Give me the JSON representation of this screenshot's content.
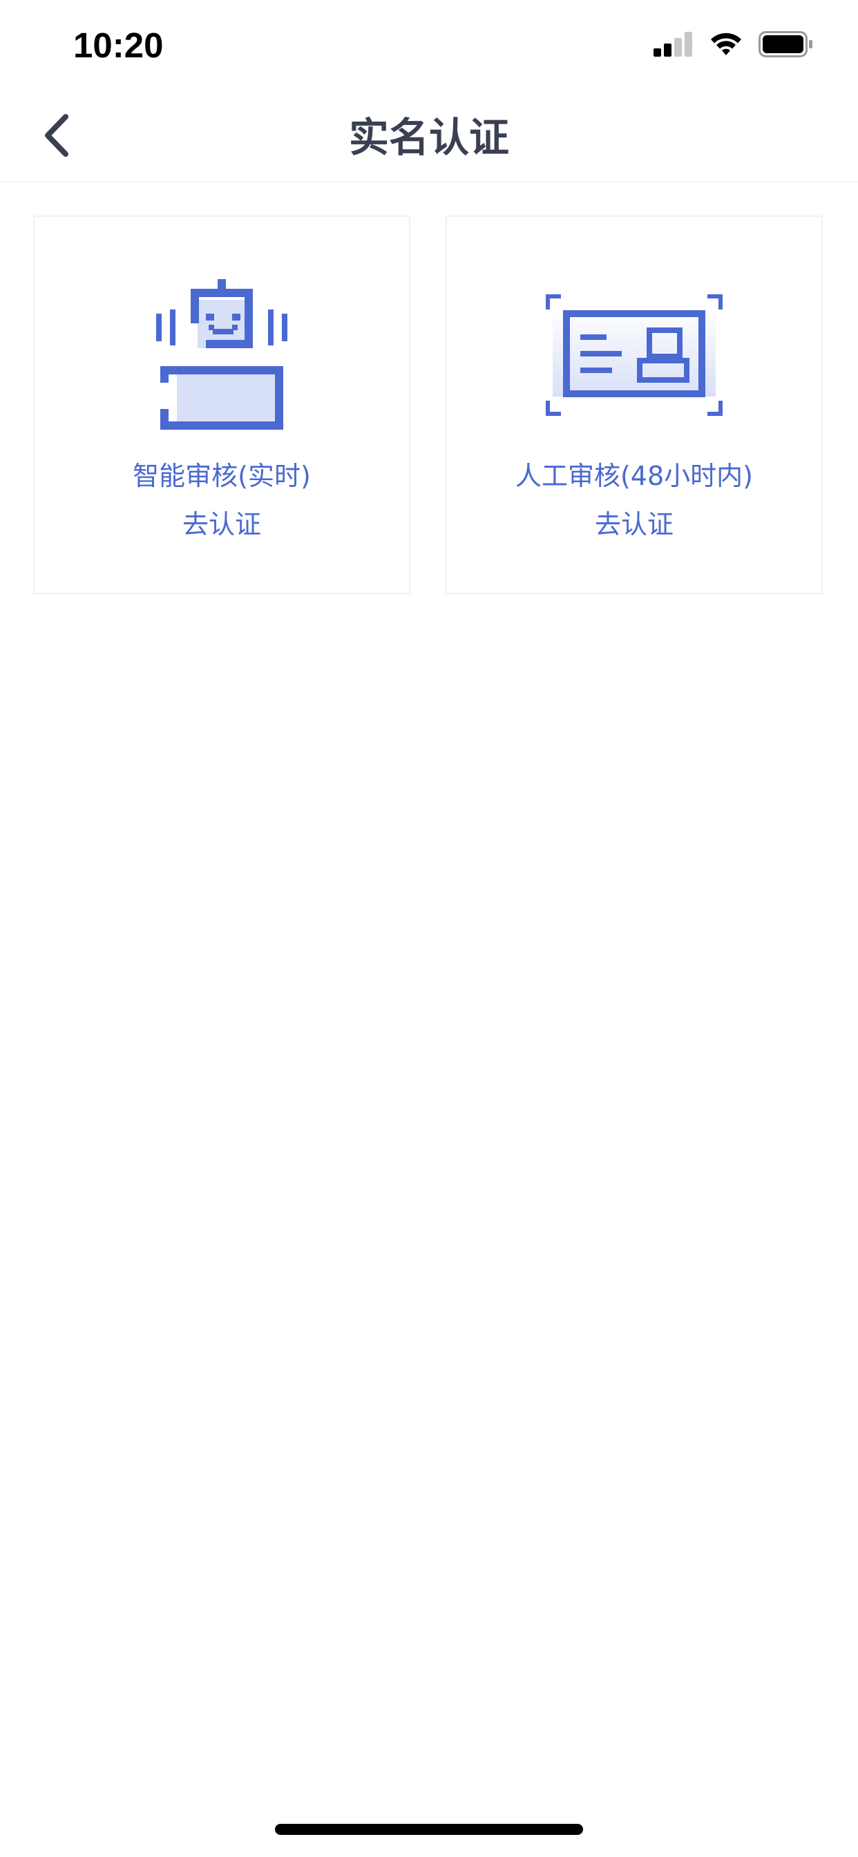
{
  "status_bar": {
    "time": "10:20",
    "icons": [
      "cellular-signal-icon",
      "wifi-icon",
      "battery-icon"
    ]
  },
  "nav": {
    "back_icon": "chevron-left-icon",
    "title": "实名认证"
  },
  "cards": [
    {
      "icon": "robot-icon",
      "title": "智能审核(实时)",
      "action": "去认证"
    },
    {
      "icon": "id-card-scan-icon",
      "title": "人工审核(48小时内)",
      "action": "去认证"
    }
  ],
  "colors": {
    "accent": "#4a69d1",
    "accent_light": "#d8e0f7",
    "title_text": "#3a3f52",
    "divider": "#f1f2f4"
  }
}
